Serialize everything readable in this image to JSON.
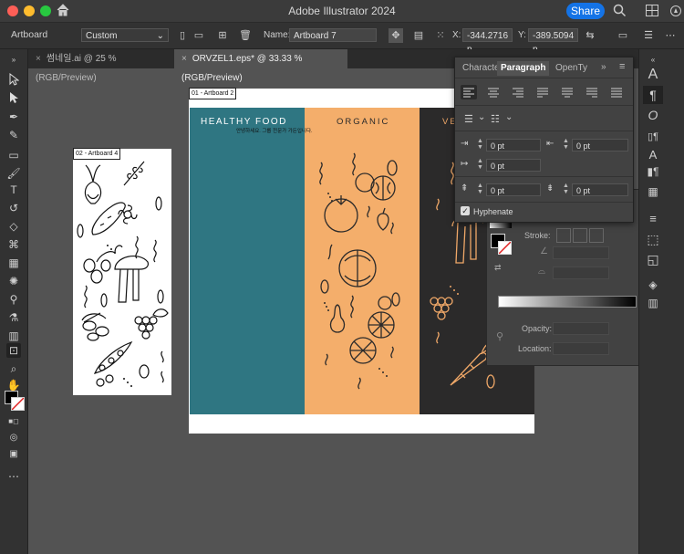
{
  "window": {
    "title": "Adobe Illustrator 2024",
    "share_label": "Share"
  },
  "control_bar": {
    "mode_label": "Artboard",
    "preset_value": "Custom",
    "name_label": "Name:",
    "name_value": "Artboard 7",
    "x_label": "X:",
    "x_value": "-344.2716 p",
    "y_label": "Y:",
    "y_value": "-389.5094 p"
  },
  "tabs": [
    {
      "label": "썸네일.ai @ 25 % (RGB/Preview)"
    },
    {
      "label": "ORVZEL1.eps* @ 33.33 % (RGB/Preview)"
    }
  ],
  "artboards": {
    "small_label": "02 - Artboard 4",
    "main_label": "01 - Artboard 2"
  },
  "design": {
    "panel1_title": "HEALTHY FOOD",
    "panel1_sub": "안녕하세요. 그룹 전문가 가든입니다.",
    "panel2_title": "ORGANIC",
    "panel3_title": "VE",
    "colors": {
      "teal": "#2f7682",
      "orange": "#f4ae6b",
      "dark": "#2b2a2a",
      "line_dark": "#2b2a2a",
      "line_orange": "#f0a868"
    }
  },
  "paragraph_panel": {
    "tab_character": "Characte",
    "tab_paragraph": "Paragraph",
    "tab_opentype": "OpenTy",
    "left_indent": "0 pt",
    "right_indent": "0 pt",
    "first_line_indent": "0 pt",
    "space_before": "0 pt",
    "space_after": "0 pt",
    "hyphenate_label": "Hyphenate",
    "hyphenate_checked": true
  },
  "properties_panel": {
    "stroke_label": "Stroke:",
    "opacity_label": "Opacity:",
    "location_label": "Location:"
  }
}
